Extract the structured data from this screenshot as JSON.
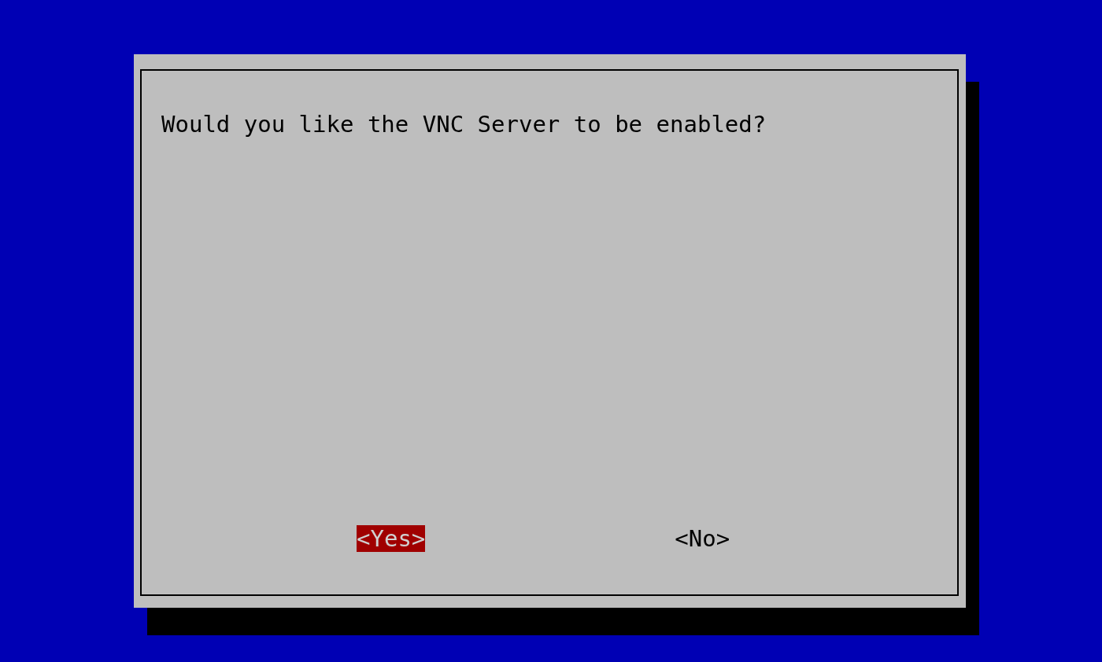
{
  "dialog": {
    "message": "Would you like the VNC Server to be enabled?",
    "buttons": [
      {
        "label": "<Yes>",
        "selected": true
      },
      {
        "label": "<No>",
        "selected": false
      }
    ]
  }
}
